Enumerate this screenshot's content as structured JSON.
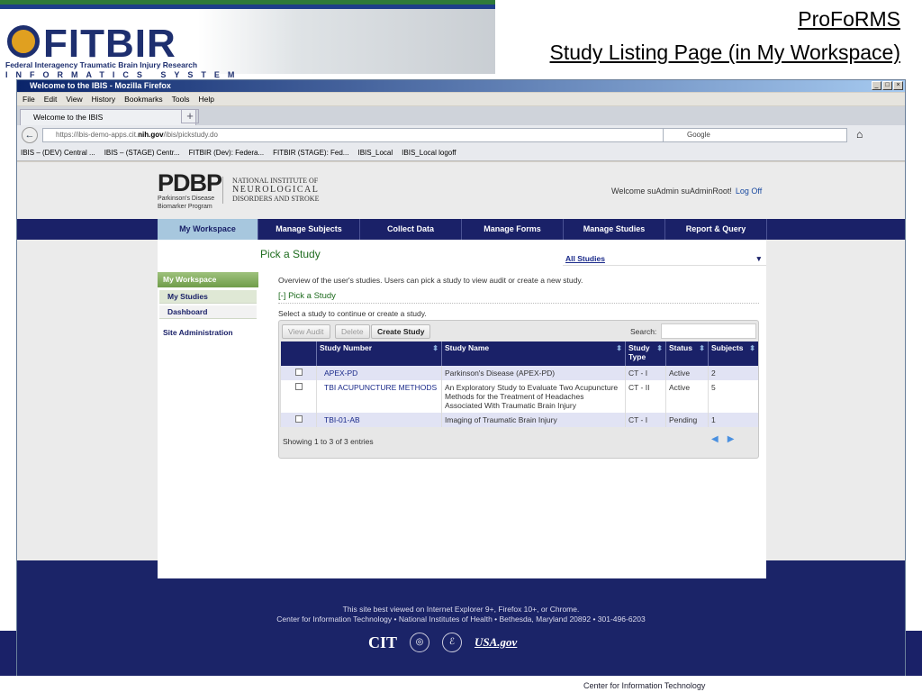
{
  "slide": {
    "logo_text": "FITBIR",
    "logo_subtitle": "Federal Interagency Traumatic Brain Injury Research",
    "logo_subtitle2": "INFORMATICS SYSTEM",
    "title": "ProFoRMS",
    "subtitle": "Study Listing Page (in My Workspace)",
    "bottom_text": "Center for Information Technology"
  },
  "browser": {
    "window_title": "Welcome to the IBIS - Mozilla Firefox",
    "menu": [
      "File",
      "Edit",
      "View",
      "History",
      "Bookmarks",
      "Tools",
      "Help"
    ],
    "tab_title": "Welcome to the IBIS",
    "url_prefix": "https://ibis-demo-apps.cit.",
    "url_domain": "nih.gov",
    "url_path": "/ibis/pickstudy.do",
    "search_placeholder": "Google",
    "bookmarks": [
      "IBIS – (DEV) Central ...",
      "IBIS – (STAGE) Centr...",
      "FITBIR (Dev): Federa...",
      "FITBIR (STAGE): Fed...",
      "IBIS_Local",
      "IBIS_Local logoff"
    ]
  },
  "header": {
    "pdbp": "PDBP",
    "pdbp_sub1": "Parkinson's Disease",
    "pdbp_sub2": "Biomarker Program",
    "ninds1": "NATIONAL INSTITUTE OF",
    "ninds2": "NEUROLOGICAL",
    "ninds3": "DISORDERS AND STROKE",
    "welcome": "Welcome suAdmin suAdminRoot!",
    "logoff": "Log Off"
  },
  "nav": [
    "My Workspace",
    "Manage Subjects",
    "Collect Data",
    "Manage Forms",
    "Manage Studies",
    "Report & Query"
  ],
  "sidebar": {
    "heading": "My Workspace",
    "items": [
      "My Studies",
      "Dashboard"
    ],
    "admin": "Site Administration"
  },
  "main": {
    "title": "Pick a Study",
    "study_filter": "All Studies",
    "overview": "Overview of the user's studies. Users can pick a study to view audit or create a new study.",
    "section": "[-] Pick a Study",
    "instruction": "Select a study to continue or create a study.",
    "buttons": {
      "view_audit": "View Audit",
      "delete": "Delete",
      "create": "Create Study"
    },
    "search_label": "Search:",
    "search_value": "",
    "columns": [
      "Study Number",
      "Study Name",
      "Study Type",
      "Status",
      "Subjects"
    ],
    "rows": [
      {
        "number": "APEX-PD",
        "name": "Parkinson's Disease (APEX-PD)",
        "type": "CT - I",
        "status": "Active",
        "subjects": "2"
      },
      {
        "number": "TBI ACUPUNCTURE METHODS",
        "name": "An Exploratory Study to Evaluate Two Acupuncture Methods for the Treatment of Headaches Associated With Traumatic Brain Injury",
        "type": "CT - II",
        "status": "Active",
        "subjects": "5"
      },
      {
        "number": "TBI-01-AB",
        "name": "Imaging of Traumatic Brain Injury",
        "type": "CT - I",
        "status": "Pending",
        "subjects": "1"
      }
    ],
    "showing": "Showing 1 to 3 of 3 entries"
  },
  "footer": {
    "line1": "This site best viewed on Internet Explorer 9+, Firefox 10+, or Chrome.",
    "line2": "Center for Information Technology  •  National Institutes of Health  •  Bethesda, Maryland 20892  •  301-496-6203",
    "cit": "CIT",
    "usa": "USA.gov"
  }
}
